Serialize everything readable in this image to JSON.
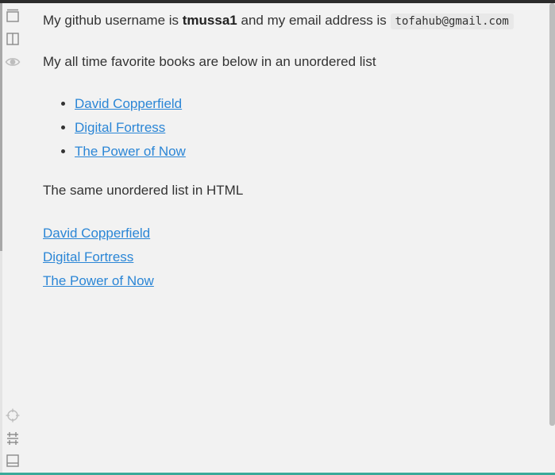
{
  "intro": {
    "prefix": "My github username is",
    "username": "tmussa1",
    "middle": "and my email address is",
    "email": "tofahub@gmail.com"
  },
  "books_heading": "My all time favorite books are below in an unordered list",
  "books": [
    "David Copperfield",
    "Digital Fortress",
    "The Power of Now"
  ],
  "html_heading": "The same unordered list in HTML",
  "html_books": [
    "David Copperfield",
    "Digital Fortress",
    "The Power of Now"
  ],
  "toolbar": {
    "icons": [
      "maximize-icon",
      "split-view-icon",
      "preview-eye-icon",
      "crosshair-icon",
      "sync-scroll-icon",
      "toggle-panel-icon"
    ]
  },
  "colors": {
    "link": "#2b86d6",
    "text": "#333333",
    "background": "#f2f2f2",
    "accent_bottom": "#3aa999"
  }
}
